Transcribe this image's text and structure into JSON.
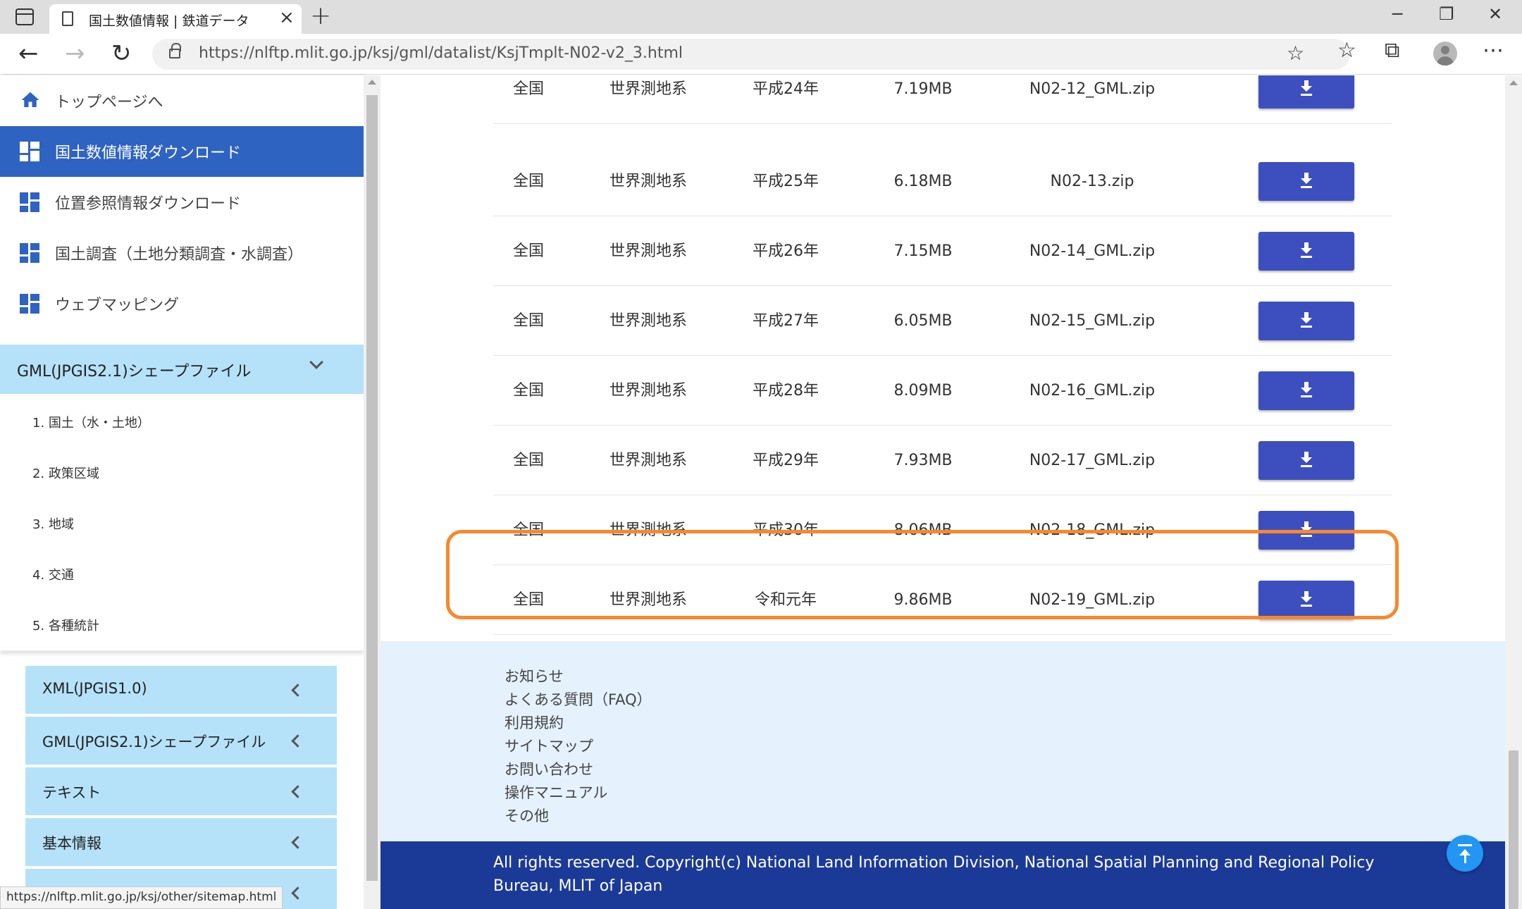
{
  "browser": {
    "tab_title": "国土数値情報 | 鉄道データ",
    "url_host": "https://nlftp.mlit.go.jp",
    "url_path": "/ksj/gml/datalist/KsjTmplt-N02-v2_3.html",
    "status_url": "https://nlftp.mlit.go.jp/ksj/other/sitemap.html"
  },
  "sidebar": {
    "nav": [
      {
        "label": "トップページへ",
        "icon": "home-icon"
      },
      {
        "label": "国土数値情報ダウンロード",
        "icon": "dashboard-icon",
        "active": true
      },
      {
        "label": "位置参照情報ダウンロード",
        "icon": "dashboard-icon"
      },
      {
        "label": "国土調査（土地分類調査・水調査）",
        "icon": "dashboard-icon"
      },
      {
        "label": "ウェブマッピング",
        "icon": "dashboard-icon"
      }
    ],
    "section_header": "GML(JPGIS2.1)シェープファイル",
    "sub_items": [
      "1. 国土（水・土地）",
      "2. 政策区域",
      "3. 地域",
      "4. 交通",
      "5. 各種統計"
    ],
    "accordions": [
      "XML(JPGIS1.0)",
      "GML(JPGIS2.1)シェープファイル",
      "テキスト",
      "基本情報"
    ]
  },
  "table": {
    "rows": [
      {
        "area": "全国",
        "datum": "世界測地系",
        "year": "平成24年",
        "size": "7.19MB",
        "file": "N02-12_GML.zip"
      },
      {
        "area": "全国",
        "datum": "世界測地系",
        "year": "平成25年",
        "size": "6.18MB",
        "file": "N02-13.zip"
      },
      {
        "area": "全国",
        "datum": "世界測地系",
        "year": "平成26年",
        "size": "7.15MB",
        "file": "N02-14_GML.zip"
      },
      {
        "area": "全国",
        "datum": "世界測地系",
        "year": "平成27年",
        "size": "6.05MB",
        "file": "N02-15_GML.zip"
      },
      {
        "area": "全国",
        "datum": "世界測地系",
        "year": "平成28年",
        "size": "8.09MB",
        "file": "N02-16_GML.zip"
      },
      {
        "area": "全国",
        "datum": "世界測地系",
        "year": "平成29年",
        "size": "7.93MB",
        "file": "N02-17_GML.zip"
      },
      {
        "area": "全国",
        "datum": "世界測地系",
        "year": "平成30年",
        "size": "8.06MB",
        "file": "N02-18_GML.zip"
      },
      {
        "area": "全国",
        "datum": "世界測地系",
        "year": "令和元年",
        "size": "9.86MB",
        "file": "N02-19_GML.zip",
        "highlighted": true
      }
    ]
  },
  "footer": {
    "links": [
      "お知らせ",
      "よくある質問（FAQ）",
      "利用規約",
      "サイトマップ",
      "お問い合わせ",
      "操作マニュアル",
      "その他"
    ],
    "copyright": "All rights reserved. Copyright(c) National Land Information Division, National Spatial Planning and Regional Policy Bureau, MLIT of Japan"
  },
  "colors": {
    "active_nav": "#2f63c2",
    "accordion": "#b5e2f9",
    "download_button": "#3d4fbe",
    "highlight": "#f7882f",
    "footer": "#e5f1fd",
    "copyright_bar": "#1b3a98"
  }
}
